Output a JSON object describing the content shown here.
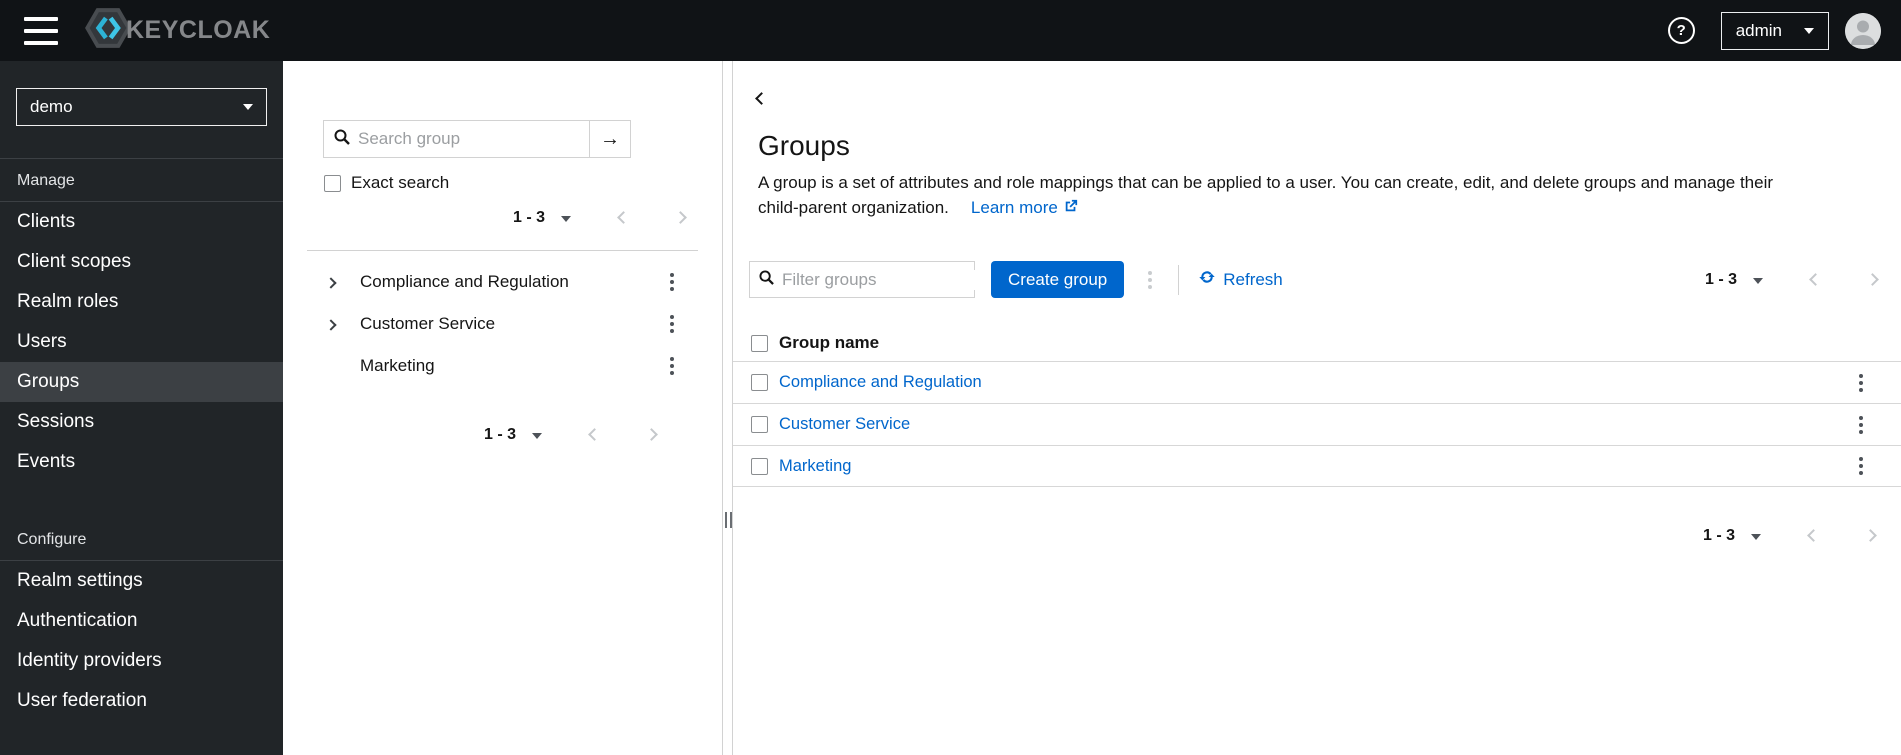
{
  "masthead": {
    "brand": "KEYCLOAK",
    "help_label": "?",
    "user_menu": {
      "label": "admin"
    }
  },
  "sidebar": {
    "realm_selector": {
      "value": "demo"
    },
    "sections": [
      {
        "label": "Manage",
        "items": [
          {
            "label": "Clients"
          },
          {
            "label": "Client scopes"
          },
          {
            "label": "Realm roles"
          },
          {
            "label": "Users"
          },
          {
            "label": "Groups",
            "active": true
          },
          {
            "label": "Sessions"
          },
          {
            "label": "Events"
          }
        ]
      },
      {
        "label": "Configure",
        "items": [
          {
            "label": "Realm settings"
          },
          {
            "label": "Authentication"
          },
          {
            "label": "Identity providers"
          },
          {
            "label": "User federation"
          }
        ]
      }
    ]
  },
  "group_tree_panel": {
    "search": {
      "placeholder": "Search group",
      "value": ""
    },
    "exact_search_label": "Exact search",
    "pagination_top": {
      "range": "1 - 3"
    },
    "items": [
      {
        "label": "Compliance and Regulation",
        "expandable": true
      },
      {
        "label": "Customer Service",
        "expandable": true
      },
      {
        "label": "Marketing",
        "expandable": false
      }
    ],
    "pagination_bottom": {
      "range": "1 - 3"
    }
  },
  "main": {
    "title": "Groups",
    "description_line1": "A group is a set of attributes and role mappings that can be applied to a user. You can create, edit, and delete groups and manage their",
    "description_line2": "child-parent organization.",
    "learn_more_label": "Learn more",
    "toolbar": {
      "filter_placeholder": "Filter groups",
      "filter_value": "",
      "create_button_label": "Create group",
      "refresh_label": "Refresh",
      "pagination": {
        "range": "1 - 3"
      }
    },
    "table": {
      "columns": [
        "Group name"
      ],
      "rows": [
        {
          "name": "Compliance and Regulation"
        },
        {
          "name": "Customer Service"
        },
        {
          "name": "Marketing"
        }
      ]
    },
    "pagination_bottom": {
      "range": "1 - 3"
    }
  },
  "colors": {
    "primary": "#0066cc",
    "link": "#0066cc",
    "masthead_bg": "#101316",
    "sidebar_bg": "#212528",
    "sidebar_active_bg": "#3c4044",
    "border": "#d2d2d2",
    "brand_cyan": "#2db3d6"
  }
}
